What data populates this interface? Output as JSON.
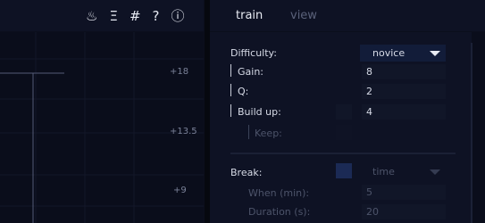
{
  "toolbar": {
    "icons": [
      "heat-waves-icon",
      "menu-icon",
      "hash-icon",
      "help-icon",
      "info-icon"
    ],
    "glyphs": {
      "heat": "♨",
      "menu": "Ξ",
      "hash": "#",
      "help": "?",
      "info": "ⓘ"
    }
  },
  "tabs": [
    {
      "label": "train",
      "active": true
    },
    {
      "label": "view",
      "active": false
    }
  ],
  "chart": {
    "y_ticks": [
      "+18",
      "+13.5",
      "+9"
    ]
  },
  "settings": {
    "difficulty": {
      "label": "Difficulty:",
      "value": "novice"
    },
    "gain": {
      "label": "Gain:",
      "value": "8"
    },
    "q": {
      "label": "Q:",
      "value": "2"
    },
    "build_up": {
      "label": "Build up:",
      "value": "4"
    },
    "keep": {
      "label": "Keep:"
    },
    "break": {
      "label": "Break:",
      "value": "time"
    },
    "when": {
      "label": "When (min):",
      "value": "5"
    },
    "duration": {
      "label": "Duration (s):",
      "value": "20"
    }
  },
  "colors": {
    "background": "#0b0e1c",
    "panel": "#0e1224",
    "accent": "#121c39",
    "text": "#d6dae6",
    "muted": "#4d546a"
  }
}
